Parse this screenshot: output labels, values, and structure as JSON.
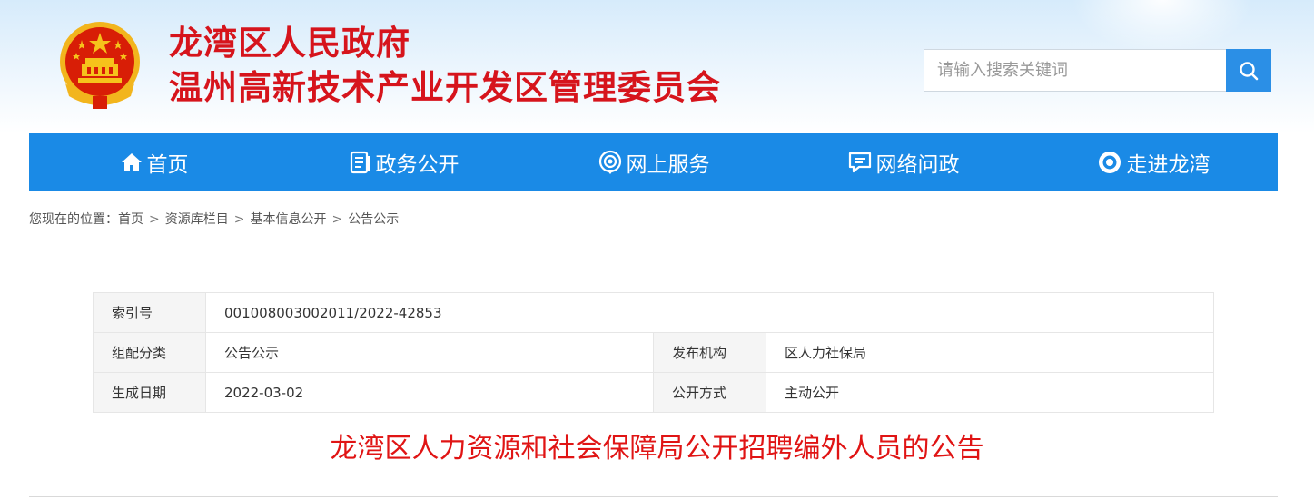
{
  "header": {
    "title_line1": "龙湾区人民政府",
    "title_line2": "温州高新技术产业开发区管理委员会",
    "brand_color": "#d6141c"
  },
  "search": {
    "placeholder": "请输入搜索关键词",
    "icon": "search-icon"
  },
  "nav": {
    "color": "#1a8ae6",
    "items": [
      {
        "label": "首页",
        "icon": "home-icon"
      },
      {
        "label": "政务公开",
        "icon": "document-icon"
      },
      {
        "label": "网上服务",
        "icon": "signal-icon"
      },
      {
        "label": "网络问政",
        "icon": "chat-icon"
      },
      {
        "label": "走进龙湾",
        "icon": "eye-icon"
      }
    ]
  },
  "breadcrumb": {
    "prefix": "您现在的位置：",
    "items": [
      "首页",
      "资源库栏目",
      "基本信息公开",
      "公告公示"
    ],
    "separator": ">"
  },
  "meta": {
    "index_label": "索引号",
    "index_value": "001008003002011/2022-42853",
    "category_label": "组配分类",
    "category_value": "公告公示",
    "publisher_label": "发布机构",
    "publisher_value": "区人力社保局",
    "date_label": "生成日期",
    "date_value": "2022-03-02",
    "disclosure_label": "公开方式",
    "disclosure_value": "主动公开"
  },
  "article": {
    "title": "龙湾区人力资源和社会保障局公开招聘编外人员的公告",
    "title_color": "#e01414"
  }
}
